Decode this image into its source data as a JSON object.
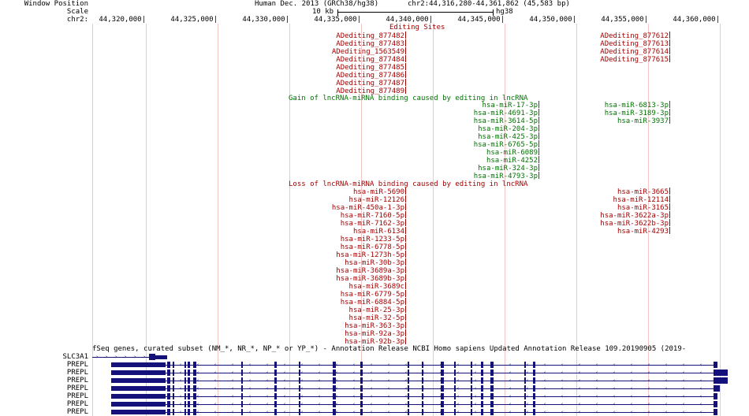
{
  "header": {
    "window_position_label": "Window Position",
    "scale_label": "Scale",
    "chr_label": "chr2:",
    "assembly": "Human Dec. 2013 (GRCh38/hg38)",
    "position": "chr2:44,316,280-44,361,862 (45,583 bp)",
    "scale_value": "10 kb",
    "scale_assembly": "hg38"
  },
  "ruler": {
    "ticks": [
      "44,320,000|",
      "44,325,000|",
      "44,330,000|",
      "44,335,000|",
      "44,340,000|",
      "44,345,000|",
      "44,350,000|",
      "44,355,000|",
      "44,360,000|"
    ]
  },
  "editing_sites": {
    "title": "Editing Sites",
    "cluster_a": [
      "ADediting_877482",
      "ADediting_877483",
      "ADediting_1563549",
      "ADediting_877484",
      "ADediting_877485",
      "ADediting_877486",
      "ADediting_877487",
      "ADediting_877489"
    ],
    "cluster_b": [
      "ADediting_877612",
      "ADediting_877613",
      "ADediting_877614",
      "ADediting_877615"
    ]
  },
  "gain_track": {
    "title": "Gain of lncRNA-miRNA binding caused by editing in lncRNA",
    "cluster_a": [
      "hsa-miR-17-3p",
      "hsa-miR-4691-3p",
      "hsa-miR-3614-5p",
      "hsa-miR-204-3p",
      "hsa-miR-425-3p",
      "hsa-miR-6765-5p",
      "hsa-miR-6089",
      "hsa-miR-4252",
      "hsa-miR-324-3p",
      "hsa-miR-4793-3p"
    ],
    "cluster_b": [
      "hsa-miR-6813-3p",
      "hsa-miR-3189-3p",
      "hsa-miR-3937"
    ]
  },
  "loss_track": {
    "title": "Loss of lncRNA-miRNA binding caused by editing in lncRNA",
    "cluster_a": [
      "hsa-miR-5690",
      "hsa-miR-12126",
      "hsa-miR-450a-1-3p",
      "hsa-miR-7160-5p",
      "hsa-miR-7162-3p",
      "hsa-miR-6134",
      "hsa-miR-1233-5p",
      "hsa-miR-6778-5p",
      "hsa-miR-1273h-5p",
      "hsa-miR-30b-3p",
      "hsa-miR-3689a-3p",
      "hsa-miR-3689b-3p",
      "hsa-miR-3689c",
      "hsa-miR-6779-5p",
      "hsa-miR-6884-5p",
      "hsa-miR-25-3p",
      "hsa-miR-32-5p",
      "hsa-miR-363-3p",
      "hsa-miR-92a-3p",
      "hsa-miR-92b-3p"
    ],
    "cluster_b": [
      "hsa-miR-3665",
      "hsa-miR-12114",
      "hsa-miR-3165",
      "hsa-miR-3622a-3p",
      "hsa-miR-3622b-3p",
      "hsa-miR-4293"
    ]
  },
  "genes_track": {
    "title": "fSeq genes, curated subset (NM_*, NR_*, NP_* or YP_*) - Annotation Release NCBI Homo sapiens Updated Annotation Release 109.20190905 (2019-",
    "rows": [
      "SLC3A1",
      "PREPL",
      "PREPL",
      "PREPL",
      "PREPL",
      "PREPL",
      "PREPL",
      "PREPL"
    ]
  },
  "colors": {
    "editing": "#a40000",
    "gain": "#007200",
    "loss": "#a40000",
    "gene": "#14127a",
    "grid": "#f3c6c6"
  }
}
